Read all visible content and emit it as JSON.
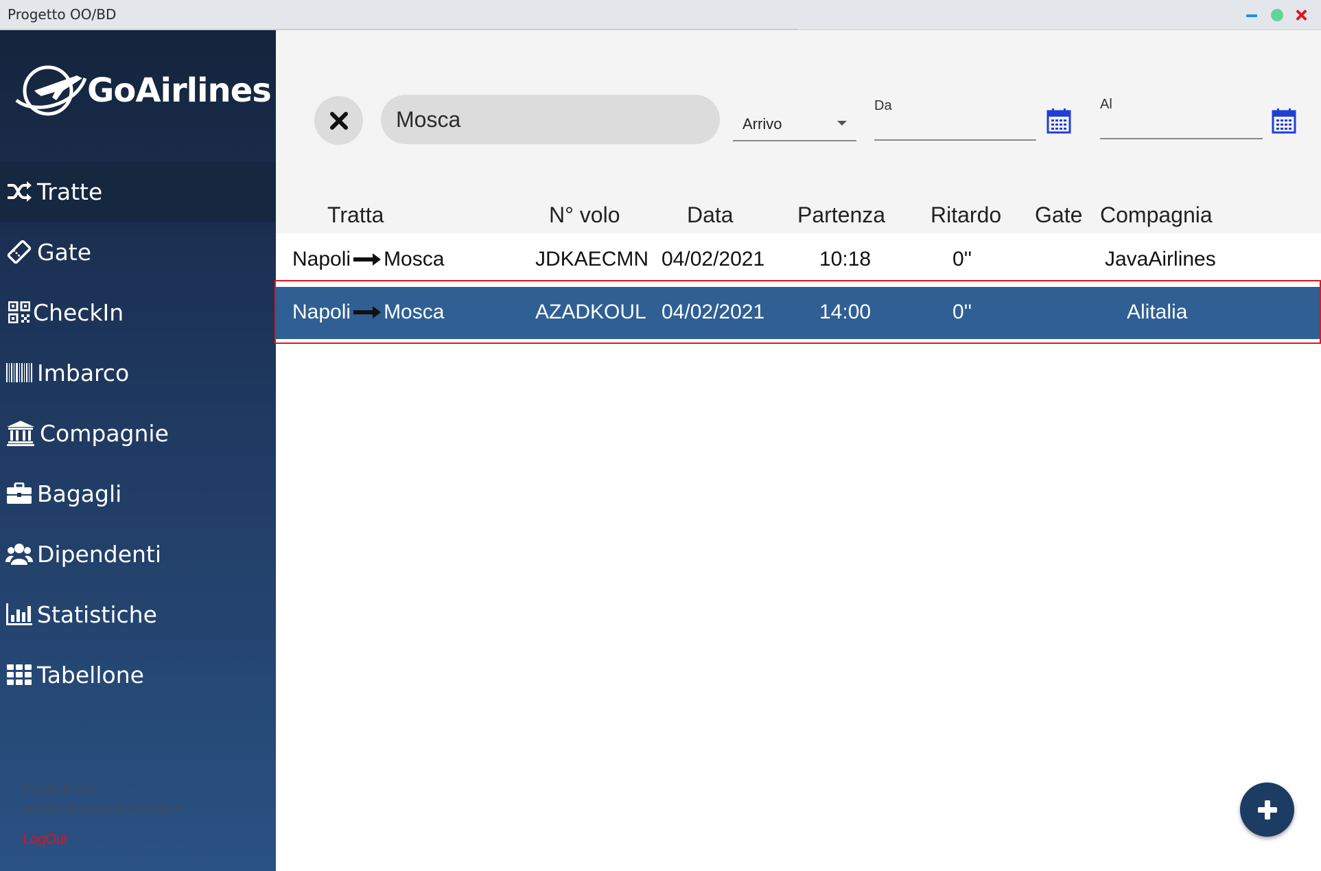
{
  "window": {
    "title": "Progetto OO/BD"
  },
  "app": {
    "brand": "GoAirlines"
  },
  "sidebar": {
    "items": [
      {
        "label": "Tratte",
        "icon": "shuffle-icon",
        "active": true
      },
      {
        "label": "Gate",
        "icon": "ticket-icon"
      },
      {
        "label": "CheckIn",
        "icon": "qrcode-icon"
      },
      {
        "label": "Imbarco",
        "icon": "barcode-icon"
      },
      {
        "label": "Compagnie",
        "icon": "bank-icon"
      },
      {
        "label": "Bagagli",
        "icon": "briefcase-icon"
      },
      {
        "label": "Dipendenti",
        "icon": "users-icon"
      },
      {
        "label": "Statistiche",
        "icon": "bar-chart-icon"
      },
      {
        "label": "Tabellone",
        "icon": "grid-icon"
      }
    ],
    "user": {
      "name": "Paolo-Rossi",
      "role": "Alitalia:Amministratore#14"
    },
    "logout_label": "LogOut"
  },
  "filters": {
    "search_value": "Mosca",
    "mode_selected": "Arrivo",
    "from_label": "Da",
    "to_label": "Al"
  },
  "table": {
    "headers": [
      "Tratta",
      "N° volo",
      "Data",
      "Partenza",
      "Ritardo",
      "Gate",
      "Compagnia"
    ],
    "rows": [
      {
        "from": "Napoli",
        "to": "Mosca",
        "flight": "JDKAECMN",
        "date": "04/02/2021",
        "departure": "10:18",
        "delay": "0''",
        "gate": "",
        "company": "JavaAirlines"
      },
      {
        "from": "Napoli",
        "to": "Mosca",
        "flight": "AZADKOUL",
        "date": "04/02/2021",
        "departure": "14:00",
        "delay": "0''",
        "gate": "",
        "company": "Alitalia"
      }
    ],
    "selected_row": 1
  },
  "colors": {
    "sidebar_top": "#15243c",
    "sidebar_bottom": "#2a5283",
    "selected_row": "#2f5f93",
    "highlight_frame": "#e0141e",
    "fab": "#1d3c63",
    "calendar_icon": "#1f3fd6"
  }
}
